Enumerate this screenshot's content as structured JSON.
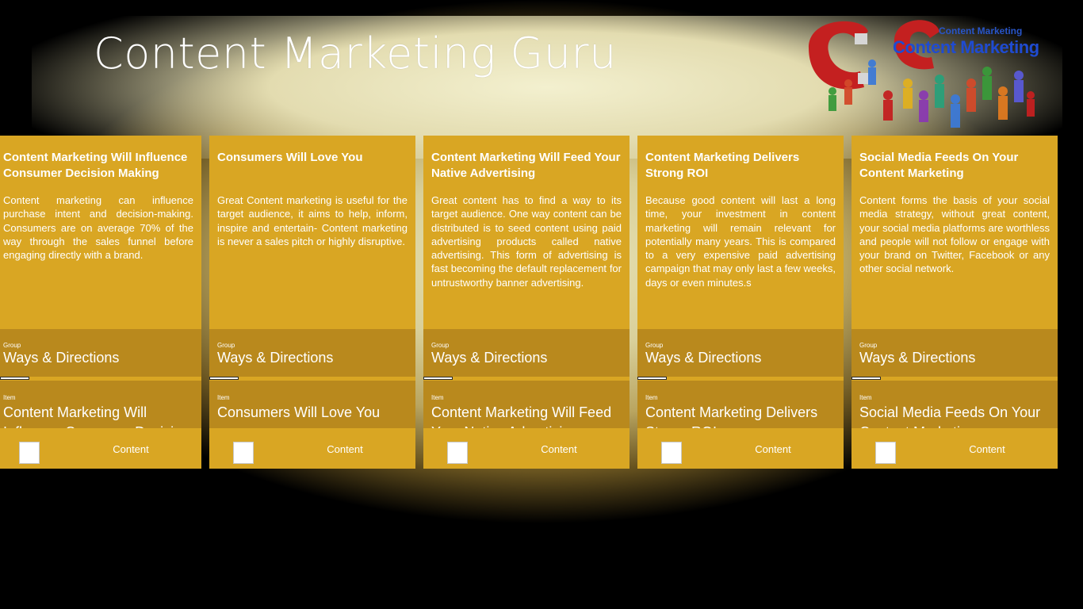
{
  "app": {
    "title": "Content Marketing Guru",
    "logo_line1": "Content Marketing",
    "logo_line2": "Content Marketing"
  },
  "cards": [
    {
      "title": "Content Marketing Will Influence Consumer Decision Making",
      "body": "Content marketing can influence purchase intent and decision-making. Consumers are on average 70% of the way through the sales funnel before engaging directly with a brand.",
      "group_label": "Group",
      "group": "Ways & Directions",
      "item_label": "Item",
      "item": "Content Marketing Will Influence Consumer Decision Making",
      "footer": "Content",
      "thumb_icon": "content-thumbnail-icon"
    },
    {
      "title": "Consumers Will Love You",
      "body": "Great Content marketing is useful for the target audience, it aims to help, inform, inspire and entertain- Content marketing is never a sales pitch or highly disruptive.",
      "group_label": "Group",
      "group": "Ways & Directions",
      "item_label": "Item",
      "item": "Consumers Will Love You",
      "footer": "Content",
      "thumb_icon": "content-thumbnail-icon"
    },
    {
      "title": "Content Marketing Will Feed Your Native Advertising",
      "body": "Great content has to find a way to its target audience. One way content can be distributed is to seed content using paid advertising products called native advertising. This form of advertising is fast becoming the default replacement for untrustworthy banner advertising.",
      "group_label": "Group",
      "group": "Ways & Directions",
      "item_label": "Item",
      "item": "Content Marketing Will Feed Your Native Advertising",
      "footer": "Content",
      "thumb_icon": "content-thumbnail-icon"
    },
    {
      "title": "Content Marketing Delivers Strong ROI",
      "body": "Because good content will last a long time, your investment in content marketing will remain relevant for potentially many years. This is compared to a very expensive paid advertising campaign that may only last a few weeks, days or even minutes.s",
      "group_label": "Group",
      "group": "Ways & Directions",
      "item_label": "Item",
      "item": "Content Marketing Delivers Strong ROI",
      "footer": "Content",
      "thumb_icon": "content-thumbnail-icon"
    },
    {
      "title": "Social Media Feeds On Your Content Marketing",
      "body": "Content forms the basis of your social media strategy, without great content, your social media platforms are worthless and people will not follow or engage with your brand on Twitter, Facebook or any other social network.",
      "group_label": "Group",
      "group": "Ways & Directions",
      "item_label": "Item",
      "item": "Social Media Feeds On Your Content Marketing",
      "footer": "Content",
      "thumb_icon": "content-thumbnail-icon"
    }
  ],
  "colors": {
    "card": "#d9a623",
    "band": "#b9891d",
    "logo_blue": "#1f4bd1"
  }
}
